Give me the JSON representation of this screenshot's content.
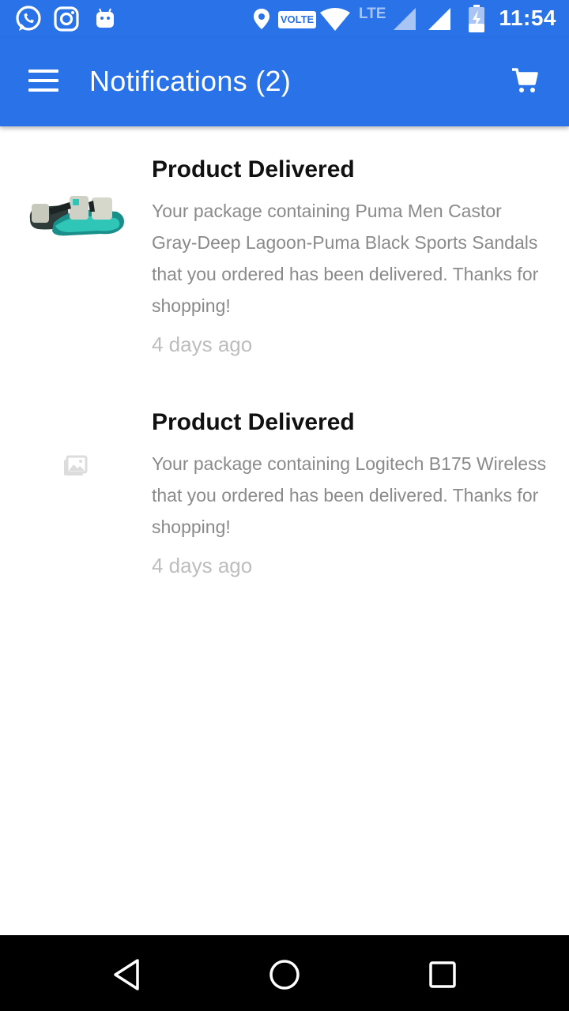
{
  "status_bar": {
    "time": "11:54",
    "volte_label": "VOLTE",
    "network_label": "LTE",
    "icons": [
      "whatsapp-icon",
      "instagram-icon",
      "android-icon",
      "location-icon",
      "volte-icon",
      "wifi-icon",
      "lte-signal-icon",
      "signal-icon",
      "battery-charging-icon"
    ]
  },
  "app_bar": {
    "title": "Notifications (2)",
    "menu_icon": "hamburger-menu-icon",
    "cart_icon": "cart-icon",
    "color": "#2a72e8"
  },
  "notifications": [
    {
      "title": "Product Delivered",
      "body": "Your package containing Puma Men Castor Gray-Deep Lagoon-Puma Black Sports Sandals that you ordered has been delivered. Thanks for shopping!",
      "time": "4 days ago",
      "thumbnail": "sandal-image"
    },
    {
      "title": "Product Delivered",
      "body": "Your package containing Logitech B175 Wireless that you ordered has been delivered. Thanks for shopping!",
      "time": "4 days ago",
      "thumbnail": "image-placeholder-icon"
    }
  ],
  "nav_bar": {
    "icons": [
      "back-icon",
      "home-icon",
      "recents-icon"
    ]
  }
}
